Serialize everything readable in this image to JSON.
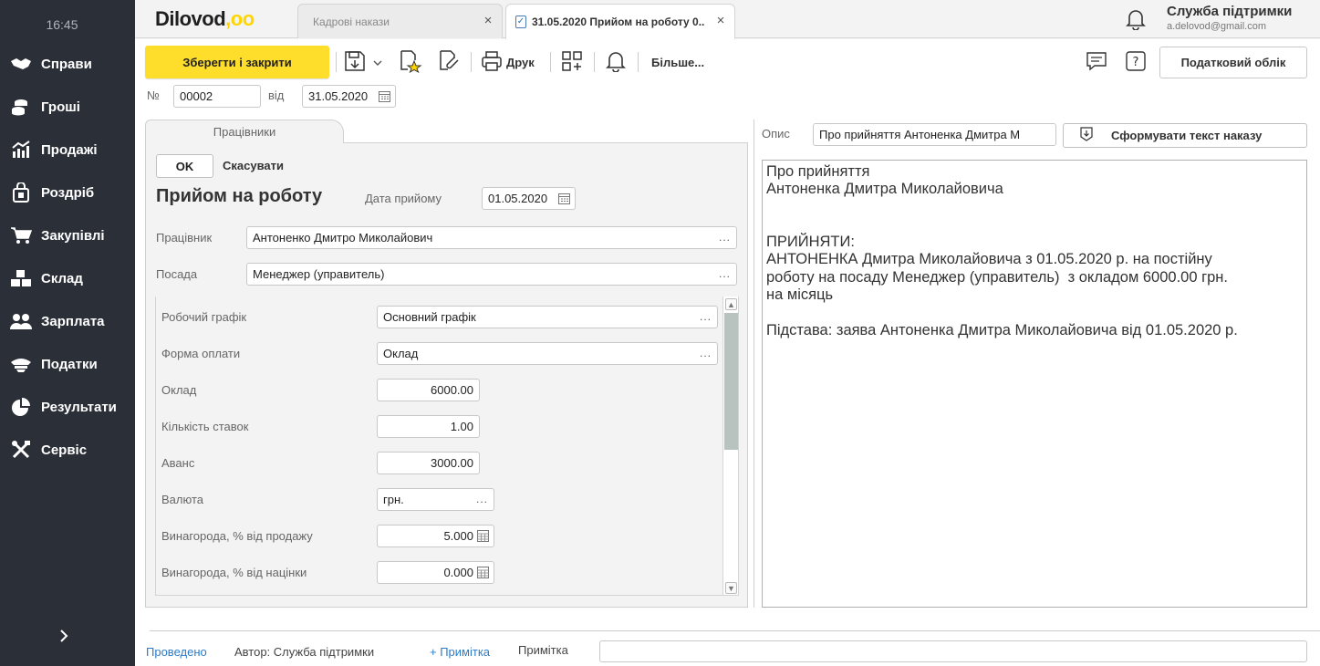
{
  "sidebar": {
    "time": "16:45",
    "items": [
      {
        "label": "Справи",
        "icon": "handshake-icon"
      },
      {
        "label": "Гроші",
        "icon": "coins-icon"
      },
      {
        "label": "Продажі",
        "icon": "chart-up-icon"
      },
      {
        "label": "Роздріб",
        "icon": "shopping-bag-icon"
      },
      {
        "label": "Закупівлі",
        "icon": "cart-icon"
      },
      {
        "label": "Склад",
        "icon": "boxes-icon"
      },
      {
        "label": "Зарплата",
        "icon": "people-icon"
      },
      {
        "label": "Податки",
        "icon": "cap-icon"
      },
      {
        "label": "Результати",
        "icon": "pie-chart-icon"
      },
      {
        "label": "Сервіс",
        "icon": "tools-icon"
      }
    ]
  },
  "header": {
    "logo_text": "Dilovod",
    "logo_dots": ",oo",
    "tabs": [
      {
        "label": "Кадрові накази"
      },
      {
        "label": "31.05.2020 Прийом на роботу 0..."
      }
    ],
    "support_name": "Служба підтримки",
    "support_email": "a.delovod@gmail.com"
  },
  "toolbar": {
    "save_close": "Зберегти і закрити",
    "print": "Друк",
    "more": "Більше...",
    "tax_accounting": "Податковий облік"
  },
  "doc": {
    "number_label": "№",
    "number": "00002",
    "date_label": "від",
    "date": "31.05.2020"
  },
  "panel": {
    "tab_label": "Працівники",
    "ok": "OK",
    "cancel": "Скасувати",
    "title": "Прийом на роботу",
    "hire_date_label": "Дата прийому",
    "hire_date": "01.05.2020",
    "employee_label": "Працівник",
    "employee": "Антоненко Дмитро Миколайович",
    "position_label": "Посада",
    "position": "Менеджер (управитель)",
    "schedule_label": "Робочий графік",
    "schedule": "Основний графік",
    "pay_form_label": "Форма оплати",
    "pay_form": "Оклад",
    "salary_label": "Оклад",
    "salary": "6000.00",
    "rates_label": "Кількість ставок",
    "rates": "1.00",
    "advance_label": "Аванс",
    "advance": "3000.00",
    "currency_label": "Валюта",
    "currency": "грн.",
    "bonus_sales_label": "Винагорода, % від продажу",
    "bonus_sales": "5.000",
    "bonus_markup_label": "Винагорода, % від націнки",
    "bonus_markup": "0.000"
  },
  "description": {
    "label": "Опис",
    "short": "Про прийняття Антоненка Дмитра М",
    "generate_button": "Сформувати текст наказу",
    "text": "Про прийняття\nАнтоненка Дмитра Миколайовича\n\n\nПРИЙНЯТИ:\nАНТОНЕНКА Дмитра Миколайовича з 01.05.2020 р. на постійну\nроботу на посаду Менеджер (управитель)  з окладом 6000.00 грн.\nна місяць\n\nПідстава: заява Антоненка Дмитра Миколайовича від 01.05.2020 р."
  },
  "footer": {
    "status": "Проведено",
    "author": "Автор: Служба підтримки",
    "add_note": "+ Примітка",
    "note_label": "Примітка",
    "note_value": ""
  },
  "colors": {
    "sidebar_bg": "#2b3038",
    "accent_yellow": "#ffdd2b",
    "link_blue": "#2c7cc8"
  }
}
